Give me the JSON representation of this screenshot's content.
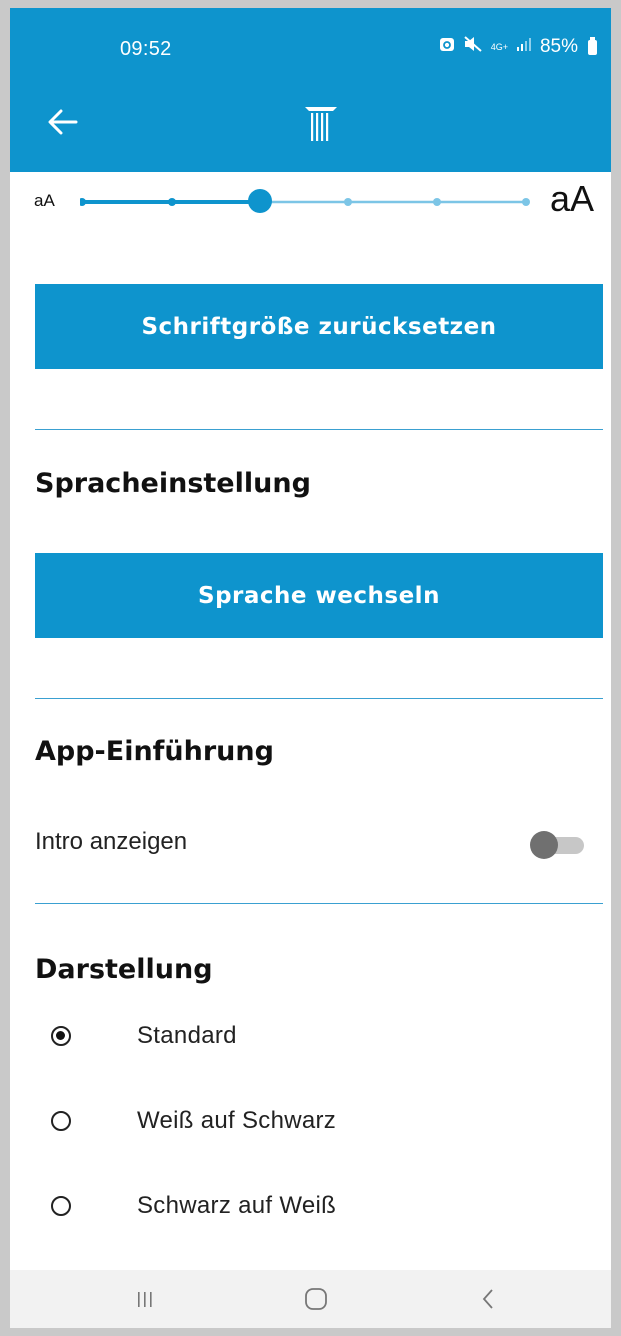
{
  "status_bar": {
    "time": "09:52",
    "network": "4G+",
    "battery": "85%"
  },
  "appbar": {
    "back_icon": "arrow-left-icon",
    "logo_icon": "pillar-logo-icon",
    "color": "#0e94cd"
  },
  "font_size_slider": {
    "small_label": "aA",
    "large_label": "aA",
    "steps": 6,
    "selected_step": 3
  },
  "reset_font_button": "Schriftgröße zurücksetzen",
  "language": {
    "heading": "Spracheinstellung",
    "button": "Sprache wechseln"
  },
  "intro": {
    "heading": "App-Einführung",
    "label": "Intro anzeigen",
    "enabled": false
  },
  "display": {
    "heading": "Darstellung",
    "options": [
      {
        "label": "Standard",
        "selected": true
      },
      {
        "label": "Weiß auf Schwarz",
        "selected": false
      },
      {
        "label": "Schwarz auf Weiß",
        "selected": false
      }
    ]
  },
  "nav": {
    "recents_icon": "recents-icon",
    "home_icon": "home-icon",
    "back_icon": "back-chevron-icon"
  }
}
